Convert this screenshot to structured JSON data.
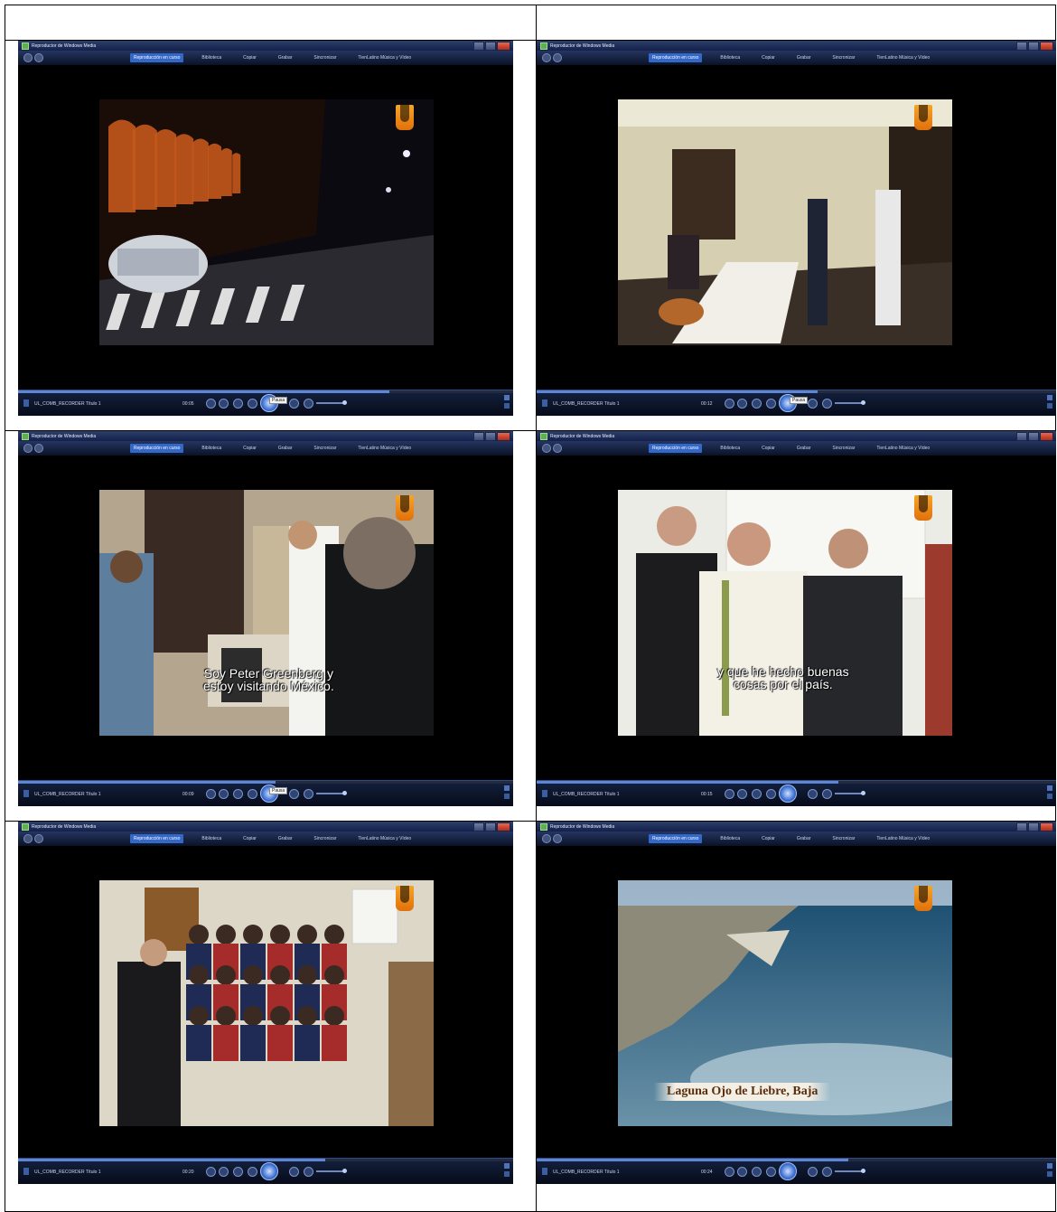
{
  "player": {
    "window_title": "Reproductor de Windows Media",
    "tabs": [
      "Reproducción en curso",
      "Biblioteca",
      "Copiar",
      "Grabar",
      "Sincronizar",
      "TienLatino Música y Vídeo"
    ],
    "now_playing": "UL_COMB_RECORDER Título 1",
    "pause_tooltip": "Pausa"
  },
  "cells": [
    {
      "scene": "night-aqueduct",
      "elapsed": "00:05",
      "seek_fraction": 0.75,
      "subtitle": [],
      "place_label": ""
    },
    {
      "scene": "dining-room",
      "elapsed": "00:12",
      "seek_fraction": 0.54,
      "subtitle": [],
      "place_label": ""
    },
    {
      "scene": "living-room-visit",
      "elapsed": "00:09",
      "seek_fraction": 0.52,
      "subtitle": [
        "Soy Peter Greenberg y",
        "estoy visitando México."
      ],
      "place_label": ""
    },
    {
      "scene": "three-men",
      "elapsed": "00:15",
      "seek_fraction": 0.58,
      "subtitle": [
        "y que he hecho buenas",
        "cosas por el país."
      ],
      "place_label": ""
    },
    {
      "scene": "school-group",
      "elapsed": "00:20",
      "seek_fraction": 0.62,
      "subtitle": [],
      "place_label": ""
    },
    {
      "scene": "aerial-coast",
      "elapsed": "00:24",
      "seek_fraction": 0.6,
      "subtitle": [],
      "place_label": "Laguna Ojo de Liebre, Baja"
    }
  ],
  "colors": {
    "logo": "#f7a427",
    "tab_active": "#3368c8",
    "chrome": "#13204a"
  }
}
